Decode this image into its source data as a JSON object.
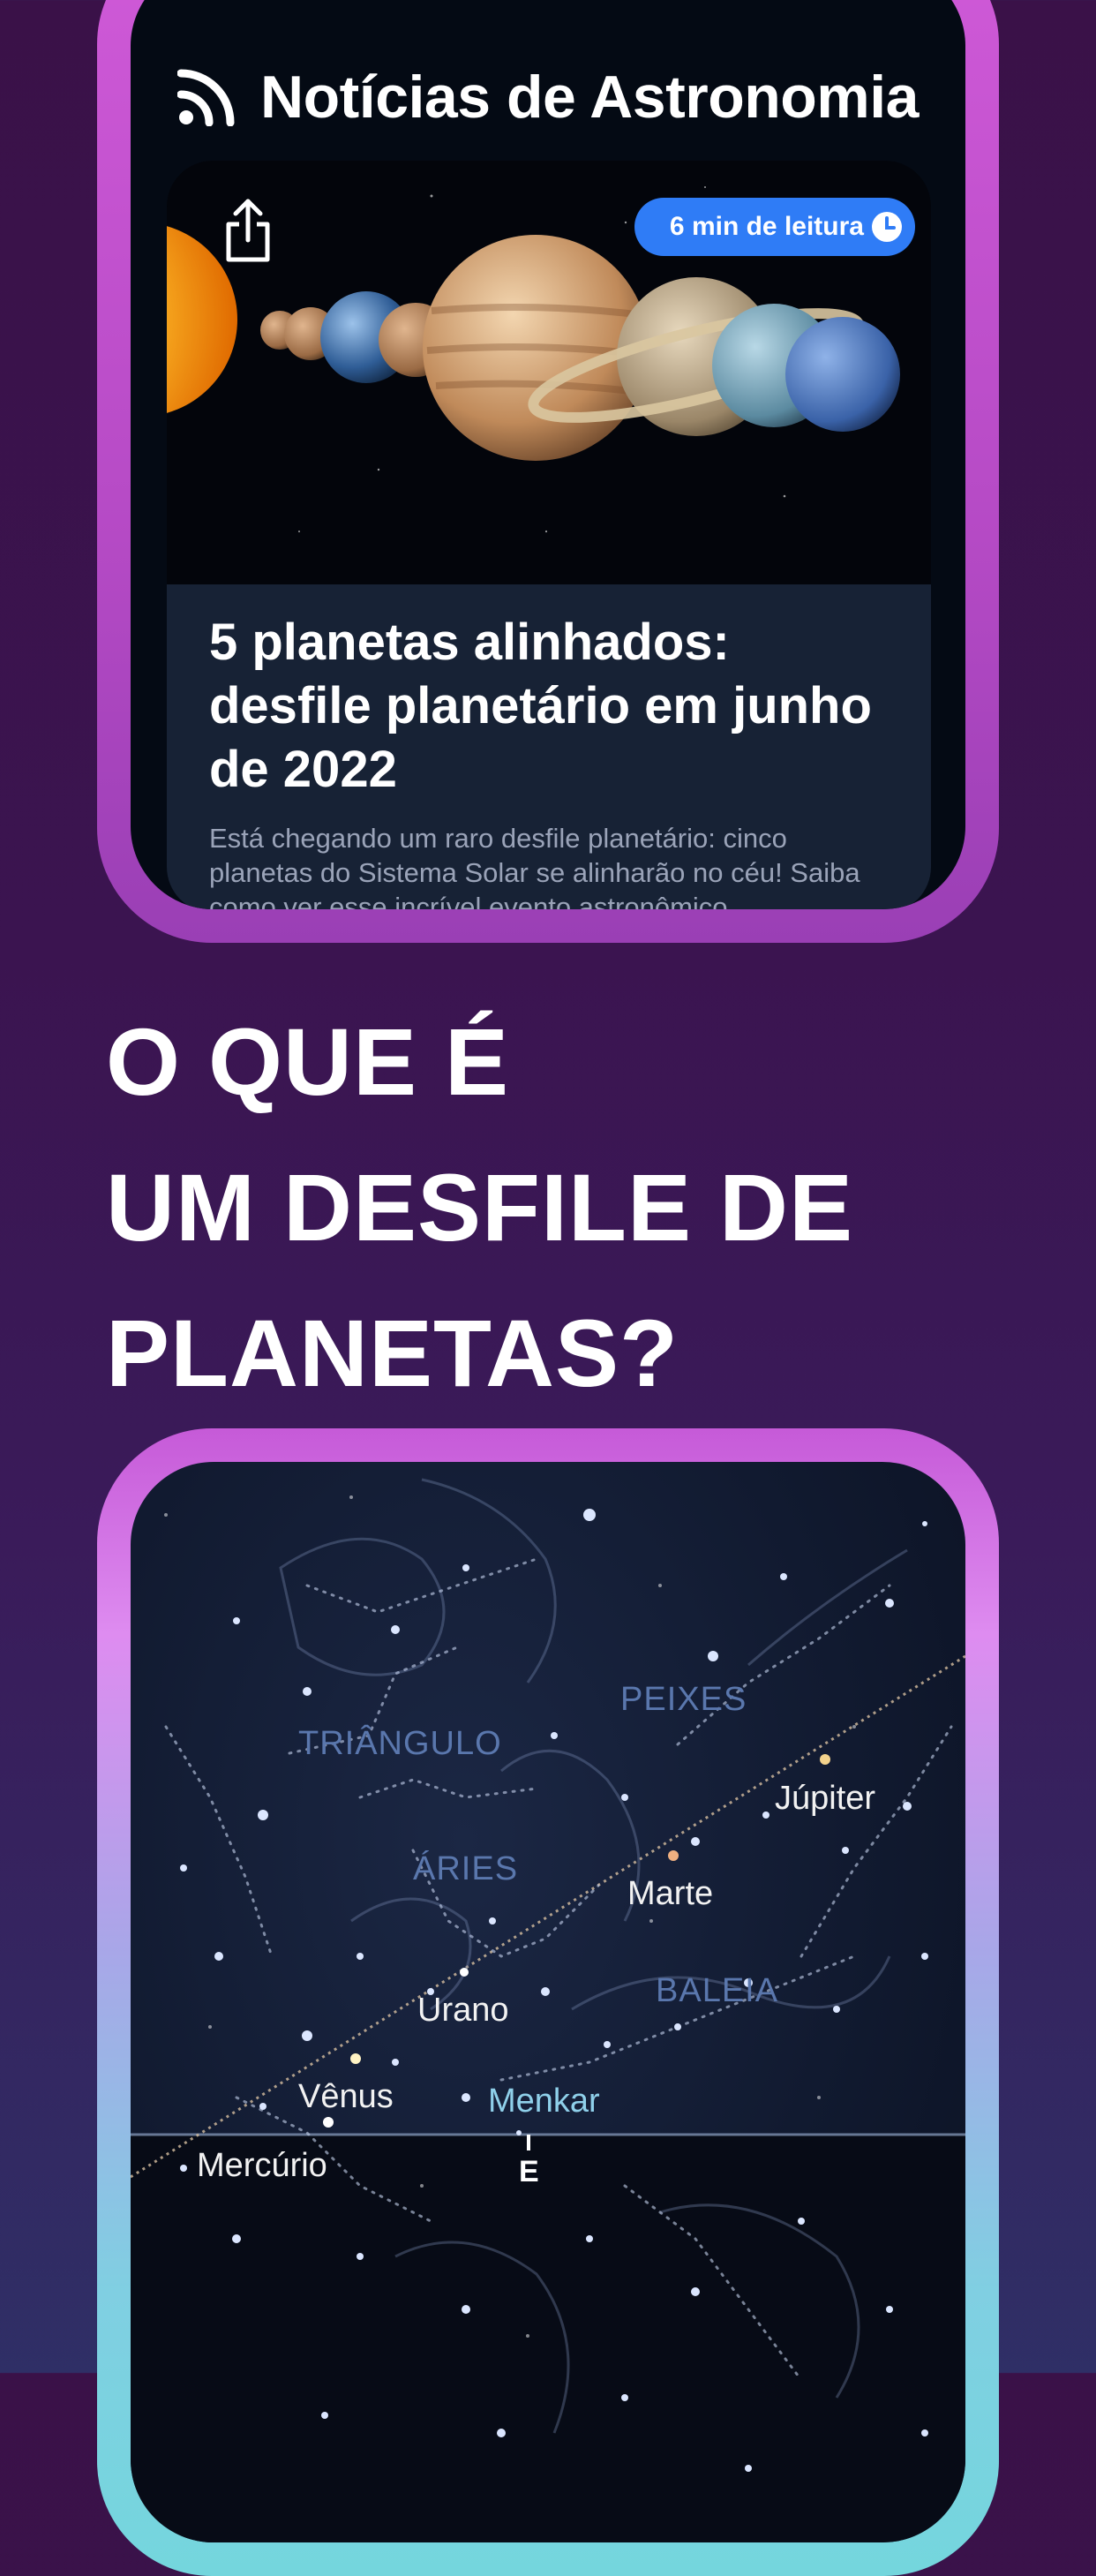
{
  "news": {
    "header_title": "Notícias de Astronomia",
    "header_icon": "rss-icon",
    "card": {
      "read_time": "6 min de leitura",
      "title": "5 planetas alinhados: desfile planetário em junho de 2022",
      "description": "Está chegando um raro desfile planetário: cinco planetas do Sistema Solar se alinharão no céu! Saiba como ver esse incrível evento astronômico.",
      "share_icon": "share-icon",
      "clock_icon": "clock-icon"
    }
  },
  "headline": {
    "line1": "O QUE É",
    "line2": "UM DESFILE DE",
    "line3": "PLANETAS?"
  },
  "sky_map": {
    "constellations": {
      "pisces": "PEIXES",
      "triangulum": "TRIÂNGULO",
      "aries": "ÁRIES",
      "cetus": "BALEIA"
    },
    "planets": {
      "jupiter": "Júpiter",
      "mars": "Marte",
      "uranus": "Urano",
      "venus": "Vênus",
      "mercury": "Mercúrio"
    },
    "stars": {
      "menkar": "Menkar"
    },
    "direction": "E"
  },
  "colors": {
    "accent_blue": "#2f7cf6",
    "frame_purple": "#b54ac5",
    "background": "#3a1448"
  }
}
